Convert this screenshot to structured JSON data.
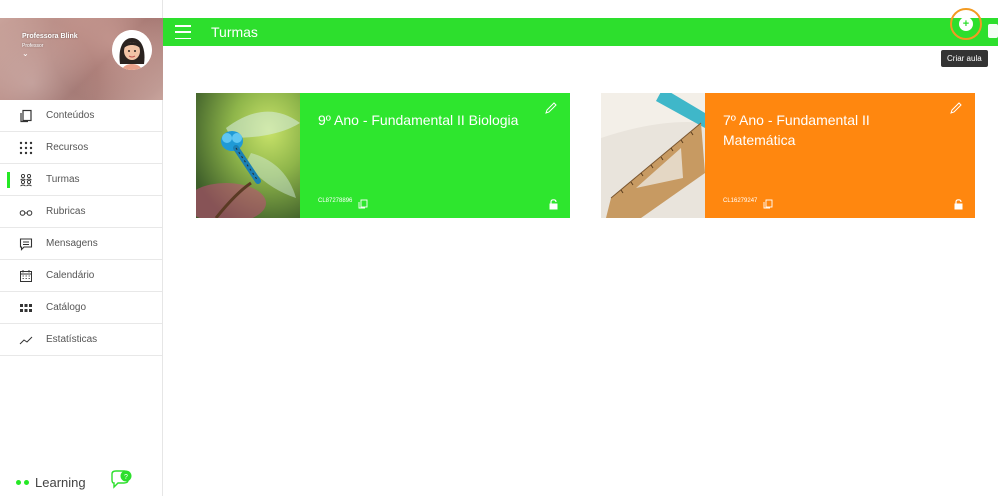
{
  "profile": {
    "name": "Professora Blink",
    "role": "Professor",
    "chevron": "⌄"
  },
  "nav": {
    "items": [
      {
        "label": "Conteúdos",
        "icon": "copy-icon"
      },
      {
        "label": "Recursos",
        "icon": "grid-dots-icon"
      },
      {
        "label": "Turmas",
        "icon": "users-icon",
        "active": true
      },
      {
        "label": "Rubricas",
        "icon": "glasses-icon"
      },
      {
        "label": "Mensagens",
        "icon": "message-icon"
      },
      {
        "label": "Calendário",
        "icon": "calendar-icon"
      },
      {
        "label": "Catálogo",
        "icon": "catalog-grid-icon"
      },
      {
        "label": "Estatísticas",
        "icon": "trend-line-icon"
      }
    ]
  },
  "brand": {
    "name": "Learning"
  },
  "topbar": {
    "title": "Turmas"
  },
  "actions": {
    "add_class_tooltip": "Criar aula"
  },
  "cards": [
    {
      "title": "9º Ano - Fundamental II Biologia",
      "code": "CL87278896",
      "color": "#2ee62e"
    },
    {
      "title": "7º Ano - Fundamental II Matemática",
      "code": "CL16279247",
      "color": "#ff870f"
    }
  ],
  "colors": {
    "accent": "#2ddf2d",
    "highlight": "#f39a22"
  }
}
